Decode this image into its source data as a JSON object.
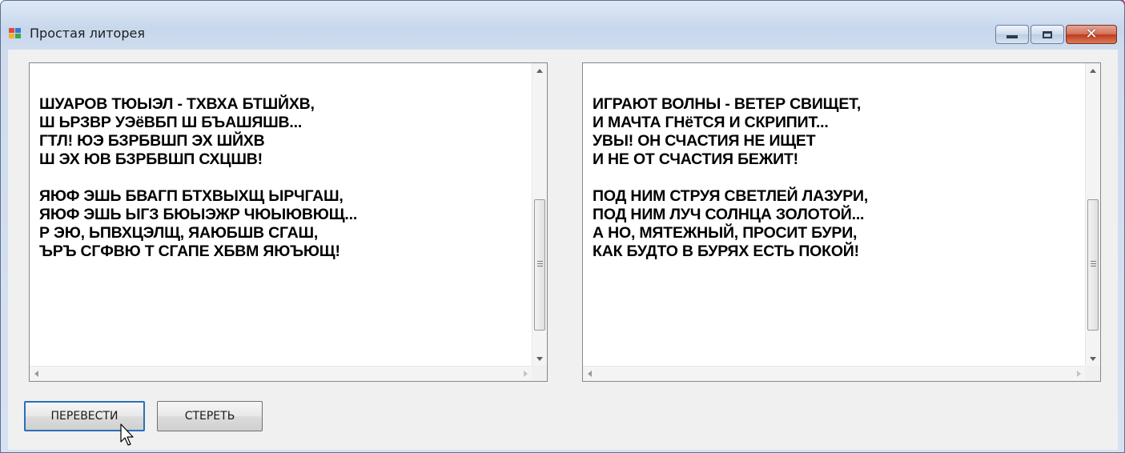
{
  "window": {
    "title": "Простая литорея",
    "controls": {
      "minimize": "minimize-icon",
      "maximize": "maximize-icon",
      "close": "✕"
    }
  },
  "left_textbox": {
    "lines": [
      "ШУАРОВ ТЮЫЭЛ - ТХВХА БТШЙХВ,",
      "Ш ЬРЗВР УЭёВБП Ш БЪАШЯШВ...",
      "ГТЛ! ЮЭ БЗРБВШП ЭХ ШЙХВ",
      "Ш ЭХ ЮВ БЗРБВШП СХЦШВ!",
      "",
      "ЯЮФ ЭШЬ БВАГП БТХВЫХЩ ЫРЧГАШ,",
      "ЯЮФ ЭШЬ ЫГЗ БЮЫЭЖР ЧЮЫЮВЮЩ...",
      "Р ЭЮ, ЬПВХЦЭЛЩ, ЯАЮБШВ СГАШ,",
      "ЪРЪ СГФВЮ Т СГАПЕ ХБВМ ЯЮЪЮЩ!"
    ]
  },
  "right_textbox": {
    "lines": [
      "ИГРАЮТ ВОЛНЫ - ВЕТЕР СВИЩЕТ,",
      "И МАЧТА ГНёТСЯ И СКРИПИТ...",
      "УВЫ! ОН СЧАСТИЯ НЕ ИЩЕТ",
      "И НЕ ОТ СЧАСТИЯ БЕЖИТ!",
      "",
      "ПОД НИМ СТРУЯ СВЕТЛЕЙ ЛАЗУРИ,",
      "ПОД НИМ ЛУЧ СОЛНЦА ЗОЛОТОЙ...",
      "А НО, МЯТЕЖНЫЙ, ПРОСИТ БУРИ,",
      "КАК БУДТО В БУРЯХ ЕСТЬ ПОКОЙ!"
    ]
  },
  "buttons": {
    "translate_label": "ПЕРЕВЕСТИ",
    "clear_label": "СТЕРЕТЬ"
  },
  "colors": {
    "accent_focus": "#2d6fb7",
    "close_button": "#c4452a",
    "client_background": "#f0f0f0"
  }
}
